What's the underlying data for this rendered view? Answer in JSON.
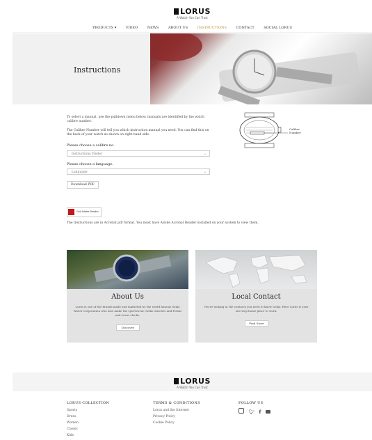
{
  "header": {
    "logo": "LORUS",
    "tagline": "A Watch You Can Trust",
    "nav": [
      {
        "label": "PRODUCTS ▾",
        "active": false
      },
      {
        "label": "VIDEO",
        "active": false
      },
      {
        "label": "NEWS",
        "active": false
      },
      {
        "label": "ABOUT US",
        "active": false
      },
      {
        "label": "INSTRUCTIONS",
        "active": true
      },
      {
        "label": "CONTACT",
        "active": false
      },
      {
        "label": "SOCIAL LORUS",
        "active": false
      }
    ]
  },
  "hero": {
    "title": "Instructions"
  },
  "instructions": {
    "intro": "To select a manual, use the pulldown menu below, manuals are identified by the watch calibre number.",
    "calibre_note": "The Calibre Number will tell you which instruction manual you need. You can find this on the back of your watch as shown on right hand side.",
    "calibre_label": "Please choose a calibre no.",
    "calibre_placeholder": "Instructions Finder",
    "language_label": "Please choose a language.",
    "language_placeholder": "Language",
    "download_button": "Download PDF",
    "diagram_callout": "Calibre Number",
    "adobe_text": "Get Adobe Reader",
    "pdf_note": "The Instructions are in Acrobat pdf format. You must have Adobe Acrobat Reader installed on your system to view them."
  },
  "cards": [
    {
      "title": "About Us",
      "text": "Lorus is one of the brands made and marketed by the world famous Seiko Watch Corporation who also make the sportswear, Seiko watches and Pulsar and Lorus clocks.",
      "button": "Discover"
    },
    {
      "title": "Local Contact",
      "text": "You're looking at the contacts you need to know today. Here Lorus is your one-stop home place to work.",
      "button": "Find Store"
    }
  ],
  "footer": {
    "logo": "LORUS",
    "tagline": "A Watch You Can Trust",
    "col1_title": "LORUS COLLECTION",
    "col1_links": [
      "Sports",
      "Dress",
      "Women",
      "Classic",
      "Kids"
    ],
    "col2_title": "TERMS & CONDITIONS",
    "col2_links": [
      "Lorus and the Internet",
      "Privacy Policy",
      "Cookie Policy"
    ],
    "col3_title": "FOLLOW US",
    "social_icons": [
      "instagram-icon",
      "twitter-icon",
      "facebook-icon",
      "youtube-icon"
    ]
  },
  "colors": {
    "accent": "#b8902f",
    "card_bg": "#e3e3e3",
    "adobe_red": "#c4161c"
  }
}
